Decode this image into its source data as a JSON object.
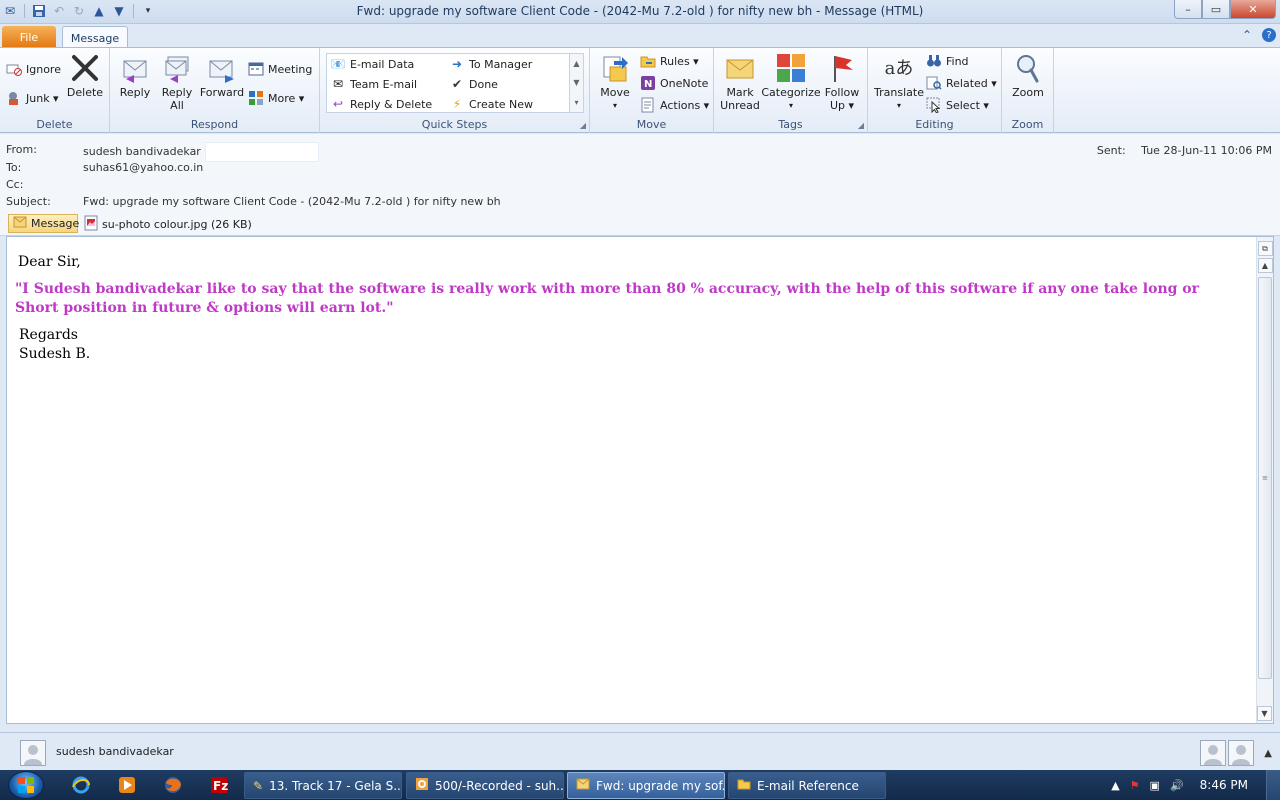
{
  "window": {
    "title": "Fwd: upgrade my software Client Code - (2042-Mu 7.2-old ) for nifty new bh  -  Message (HTML)",
    "minimize": "–",
    "maximize": "▭",
    "close": "✕"
  },
  "tabs": {
    "file": "File",
    "message": "Message"
  },
  "ribbon": {
    "delete_group": {
      "label": "Delete",
      "ignore": "Ignore",
      "junk": "Junk ▾",
      "delete": "Delete"
    },
    "respond_group": {
      "label": "Respond",
      "reply": "Reply",
      "reply_all_1": "Reply",
      "reply_all_2": "All",
      "forward": "Forward",
      "meeting": "Meeting",
      "more": "More ▾"
    },
    "quicksteps_group": {
      "label": "Quick Steps",
      "email_data": "E-mail Data",
      "team_email": "Team E-mail",
      "reply_delete": "Reply & Delete",
      "to_manager": "To Manager",
      "done": "Done",
      "create_new": "Create New"
    },
    "move_group": {
      "label": "Move",
      "move": "Move",
      "rules": "Rules ▾",
      "onenote": "OneNote",
      "actions": "Actions ▾"
    },
    "tags_group": {
      "label": "Tags",
      "mark_unread_1": "Mark",
      "mark_unread_2": "Unread",
      "categorize": "Categorize",
      "follow_up_1": "Follow",
      "follow_up_2": "Up ▾"
    },
    "editing_group": {
      "label": "Editing",
      "translate": "Translate",
      "find": "Find",
      "related": "Related ▾",
      "select": "Select ▾"
    },
    "zoom_group": {
      "label": "Zoom",
      "zoom": "Zoom"
    }
  },
  "header": {
    "from_label": "From:",
    "from_value": "sudesh bandivadekar",
    "to_label": "To:",
    "to_value": "suhas61@yahoo.co.in",
    "cc_label": "Cc:",
    "subject_label": "Subject:",
    "subject_value": "Fwd: upgrade my software Client Code - (2042-Mu 7.2-old ) for nifty new bh",
    "sent_label": "Sent:",
    "sent_value": "Tue 28-Jun-11 10:06 PM"
  },
  "attachments": {
    "message_tab": "Message",
    "file": "su-photo colour.jpg (26 KB)"
  },
  "body": {
    "greeting": "Dear Sir,",
    "quote": "\"I Sudesh bandivadekar like to say that the software is really work with more than 80 % accuracy, with the help of this software if any one take long or Short position in future & options will earn lot.\"",
    "regards": "Regards",
    "signature": "Sudesh B."
  },
  "people_pane": {
    "name": "sudesh bandivadekar"
  },
  "taskbar": {
    "tasks": [
      {
        "label": "13. Track 17 - Gela S..."
      },
      {
        "label": "500/-Recorded - suh..."
      },
      {
        "label": "Fwd: upgrade my sof..."
      },
      {
        "label": "E-mail Reference"
      }
    ],
    "clock": "8:46 PM"
  },
  "colors": {
    "quote_text": "#c039c6",
    "file_tab": "#e2770f",
    "taskbar": "#1f3c62"
  }
}
